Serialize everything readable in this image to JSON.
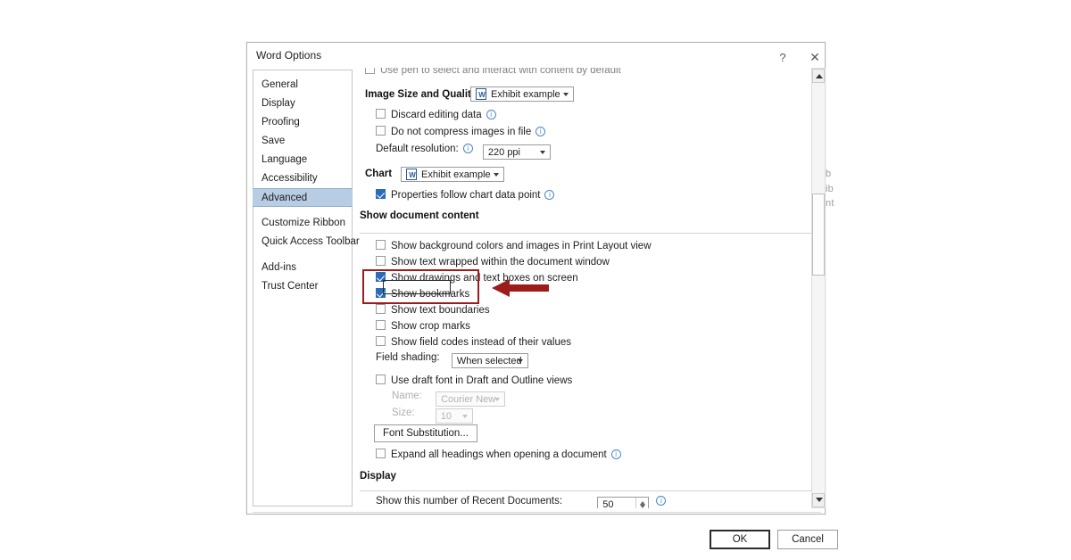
{
  "window": {
    "title": "Word Options",
    "help_icon": "?",
    "close_icon": "✕"
  },
  "sidebar": {
    "items": [
      {
        "label": "General",
        "selected": false
      },
      {
        "label": "Display",
        "selected": false
      },
      {
        "label": "Proofing",
        "selected": false
      },
      {
        "label": "Save",
        "selected": false
      },
      {
        "label": "Language",
        "selected": false
      },
      {
        "label": "Accessibility",
        "selected": false
      },
      {
        "label": "Advanced",
        "selected": true
      },
      {
        "label": "Customize Ribbon",
        "selected": false
      },
      {
        "label": "Quick Access Toolbar",
        "selected": false
      },
      {
        "label": "Add-ins",
        "selected": false
      },
      {
        "label": "Trust Center",
        "selected": false
      }
    ]
  },
  "content": {
    "clipped_top_row": "Use pen to select and interact with content by default",
    "image_quality": {
      "heading": "Image Size and Quality",
      "scope_combo_value": "Exhibit example",
      "discard_editing_data": "Discard editing data",
      "do_not_compress": "Do not compress images in file",
      "default_resolution_label": "Default resolution:",
      "default_resolution_value": "220 ppi"
    },
    "chart": {
      "heading": "Chart",
      "scope_combo_value": "Exhibit example",
      "properties_follow": "Properties follow chart data point"
    },
    "show_document_content": {
      "heading": "Show document content",
      "options": [
        {
          "label": "Show background colors and images in Print Layout view",
          "checked": false
        },
        {
          "label": "Show text wrapped within the document window",
          "checked": false
        },
        {
          "label": "Show drawings and text boxes on screen",
          "checked": true
        },
        {
          "label": "Show bookmarks",
          "checked": true
        },
        {
          "label": "Show text boundaries",
          "checked": false
        },
        {
          "label": "Show crop marks",
          "checked": false
        },
        {
          "label": "Show field codes instead of their values",
          "checked": false
        }
      ],
      "field_shading_label": "Field shading:",
      "field_shading_value": "When selected",
      "use_draft_font": "Use draft font in Draft and Outline views",
      "font_name_label": "Name:",
      "font_name_value": "Courier New",
      "font_size_label": "Size:",
      "font_size_value": "10",
      "font_substitution_button": "Font Substitution...",
      "expand_all_headings": "Expand all headings when opening a document"
    },
    "display": {
      "heading": "Display",
      "recent_documents_label": "Show this number of Recent Documents:",
      "recent_documents_value": "50"
    }
  },
  "footer": {
    "ok": "OK",
    "cancel": "Cancel"
  },
  "annotation": {
    "highlight_color": "#9e1b1b",
    "arrow_color": "#9e1b1b",
    "target_option": "Show bookmarks"
  },
  "background_fragments": [
    "b",
    "ib",
    "nt"
  ]
}
